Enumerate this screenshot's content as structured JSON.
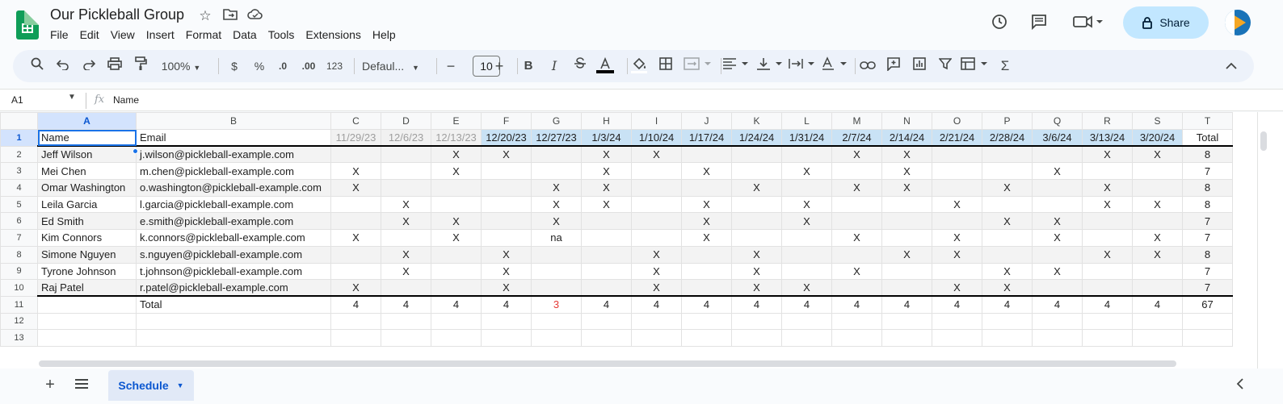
{
  "document": {
    "title": "Our Pickleball Group"
  },
  "menu": [
    "File",
    "Edit",
    "View",
    "Insert",
    "Format",
    "Data",
    "Tools",
    "Extensions",
    "Help"
  ],
  "share_label": "Share",
  "toolbar": {
    "zoom": "100%",
    "currency": "$",
    "percent": "%",
    "decrease_decimal": ".0",
    "increase_decimal": ".00",
    "number_format": "123",
    "font": "Defaul...",
    "font_size": "10",
    "bold": "B",
    "italic": "I",
    "sigma": "Σ"
  },
  "formula_bar": {
    "cell_ref": "A1",
    "fx": "fx",
    "value": "Name"
  },
  "columns": [
    "A",
    "B",
    "C",
    "D",
    "E",
    "F",
    "G",
    "H",
    "I",
    "J",
    "K",
    "L",
    "M",
    "N",
    "O",
    "P",
    "Q",
    "R",
    "S",
    "T"
  ],
  "header": {
    "name": "Name",
    "email": "Email",
    "dates": [
      "11/29/23",
      "12/6/23",
      "12/13/23",
      "12/20/23",
      "12/27/23",
      "1/3/24",
      "1/10/24",
      "1/17/24",
      "1/24/24",
      "1/31/24",
      "2/7/24",
      "2/14/24",
      "2/21/24",
      "2/28/24",
      "3/6/24",
      "3/13/24",
      "3/20/24"
    ],
    "total": "Total"
  },
  "players": [
    {
      "name": "Jeff Wilson",
      "email": "j.wilson@pickleball-example.com",
      "marks": [
        "",
        "",
        "X",
        "X",
        "",
        "X",
        "X",
        "",
        "",
        "",
        "X",
        "X",
        "",
        "",
        "",
        "X",
        "X"
      ],
      "total": "8"
    },
    {
      "name": "Mei Chen",
      "email": "m.chen@pickleball-example.com",
      "marks": [
        "X",
        "",
        "X",
        "",
        "",
        "X",
        "",
        "X",
        "",
        "X",
        "",
        "X",
        "",
        "",
        "X",
        "",
        ""
      ],
      "total": "7"
    },
    {
      "name": "Omar Washington",
      "email": "o.washington@pickleball-example.com",
      "marks": [
        "X",
        "",
        "",
        "",
        "X",
        "X",
        "",
        "",
        "X",
        "",
        "X",
        "X",
        "",
        "X",
        "",
        "X",
        ""
      ],
      "total": "8"
    },
    {
      "name": "Leila Garcia",
      "email": "l.garcia@pickleball-example.com",
      "marks": [
        "",
        "X",
        "",
        "",
        "X",
        "X",
        "",
        "X",
        "",
        "X",
        "",
        "",
        "X",
        "",
        "",
        "X",
        "X"
      ],
      "total": "8"
    },
    {
      "name": "Ed Smith",
      "email": "e.smith@pickleball-example.com",
      "marks": [
        "",
        "X",
        "X",
        "",
        "X",
        "",
        "",
        "X",
        "",
        "X",
        "",
        "",
        "",
        "X",
        "X",
        "",
        ""
      ],
      "total": "7"
    },
    {
      "name": "Kim Connors",
      "email": "k.connors@pickleball-example.com",
      "marks": [
        "X",
        "",
        "X",
        "",
        "na",
        "",
        "",
        "X",
        "",
        "",
        "X",
        "",
        "X",
        "",
        "X",
        "",
        "X"
      ],
      "total": "7"
    },
    {
      "name": "Simone Nguyen",
      "email": "s.nguyen@pickleball-example.com",
      "marks": [
        "",
        "X",
        "",
        "X",
        "",
        "",
        "X",
        "",
        "X",
        "",
        "",
        "X",
        "X",
        "",
        "",
        "X",
        "X"
      ],
      "total": "8"
    },
    {
      "name": "Tyrone Johnson",
      "email": "t.johnson@pickleball-example.com",
      "marks": [
        "",
        "X",
        "",
        "X",
        "",
        "",
        "X",
        "",
        "X",
        "",
        "X",
        "",
        "",
        "X",
        "X",
        "",
        ""
      ],
      "total": "7"
    },
    {
      "name": "Raj Patel",
      "email": "r.patel@pickleball-example.com",
      "marks": [
        "X",
        "",
        "",
        "X",
        "",
        "",
        "X",
        "",
        "X",
        "X",
        "",
        "",
        "X",
        "X",
        "",
        "",
        ""
      ],
      "total": "7"
    }
  ],
  "totals": {
    "label": "Total",
    "values": [
      "4",
      "4",
      "4",
      "4",
      "3",
      "4",
      "4",
      "4",
      "4",
      "4",
      "4",
      "4",
      "4",
      "4",
      "4",
      "4",
      "4"
    ],
    "grand_total": "67",
    "highlight_color": "#e53935"
  },
  "row_numbers": [
    "1",
    "2",
    "3",
    "4",
    "5",
    "6",
    "7",
    "8",
    "9",
    "10",
    "11",
    "12",
    "13"
  ],
  "sheet_tab": "Schedule",
  "colors": {
    "sheets_green": "#0f9d58",
    "share_bg": "#c2e7ff",
    "future_date_bg": "#c9e2f5",
    "selection_blue": "#1a73e8"
  }
}
